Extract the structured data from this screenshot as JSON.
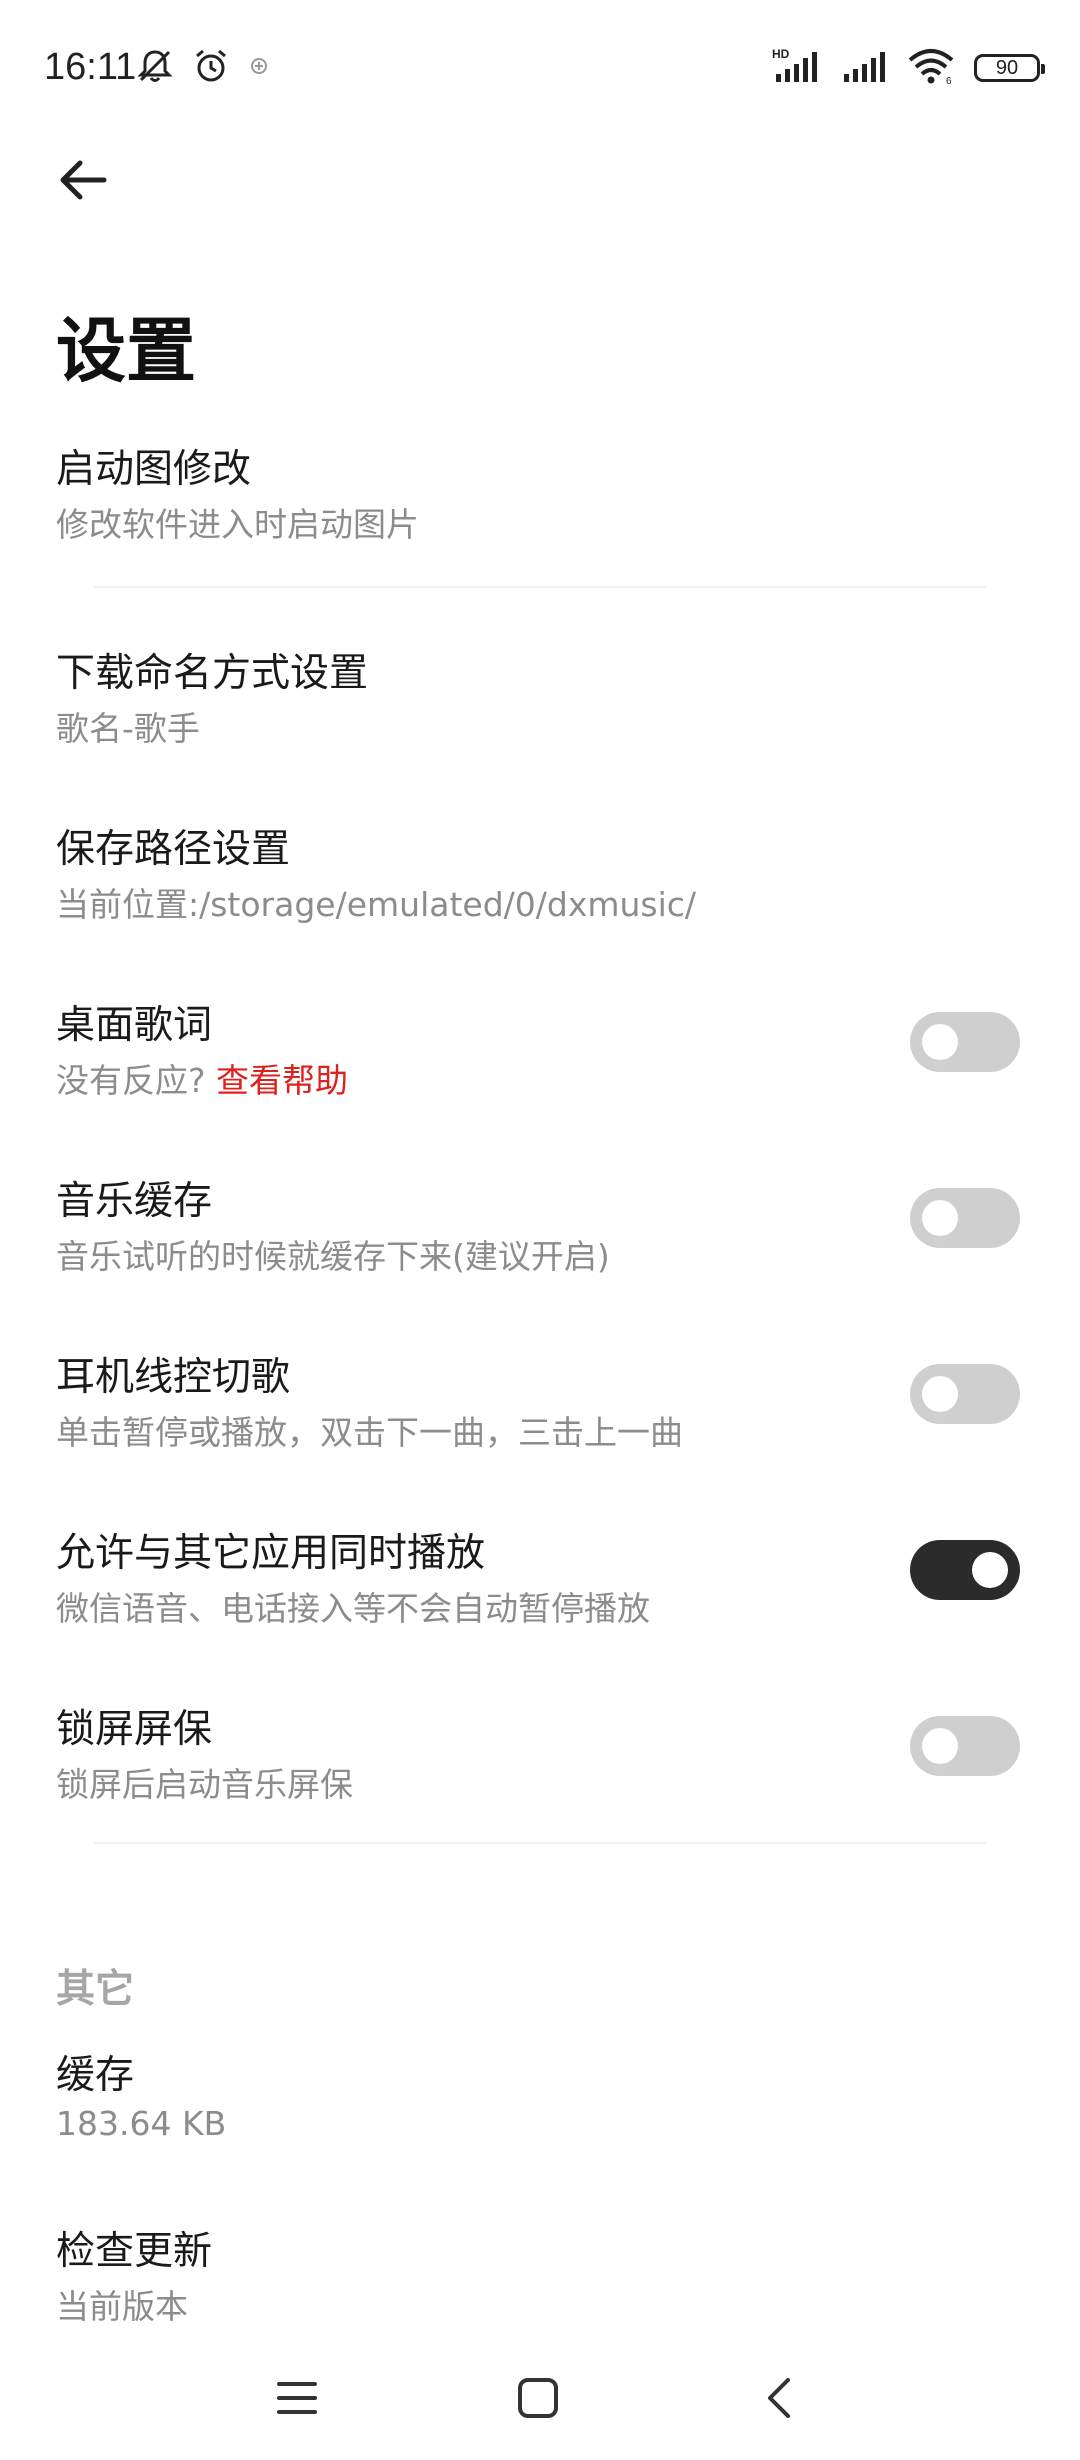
{
  "status_bar": {
    "time": "16:11",
    "battery": "90",
    "icons": [
      "bell-muted-icon",
      "alarm-icon",
      "app-notification-icon",
      "hd-signal-icon",
      "signal-icon",
      "wifi-icon",
      "battery-icon"
    ]
  },
  "header": {
    "back_icon": "arrow-left-icon",
    "title": "设置"
  },
  "settings": [
    {
      "title": "启动图修改",
      "subtitle": "修改软件进入时启动图片"
    },
    {
      "title": "下载命名方式设置",
      "subtitle": "歌名-歌手"
    },
    {
      "title": "保存路径设置",
      "subtitle": "当前位置:/storage/emulated/0/dxmusic/"
    },
    {
      "title": "桌面歌词",
      "subtitle": "没有反应?",
      "link": "查看帮助",
      "toggle": false
    },
    {
      "title": "音乐缓存",
      "subtitle": "音乐试听的时候就缓存下来(建议开启)",
      "toggle": false
    },
    {
      "title": "耳机线控切歌",
      "subtitle": "单击暂停或播放，双击下一曲，三击上一曲",
      "toggle": false
    },
    {
      "title": "允许与其它应用同时播放",
      "subtitle": "微信语音、电话接入等不会自动暂停播放",
      "toggle": true
    },
    {
      "title": "锁屏屏保",
      "subtitle": "锁屏后启动音乐屏保",
      "toggle": false
    }
  ],
  "other_section": {
    "header": "其它",
    "items": [
      {
        "title": "缓存",
        "subtitle": "183.64 KB"
      },
      {
        "title": "检查更新",
        "subtitle": "当前版本"
      }
    ]
  },
  "nav_bar": {
    "icons": [
      "menu-icon",
      "home-icon",
      "back-icon"
    ]
  },
  "colors": {
    "accent_link": "#e0201c",
    "toggle_on": "#2b2b2b",
    "toggle_off": "#cfcfcf",
    "subtitle": "#8c8c8c"
  }
}
